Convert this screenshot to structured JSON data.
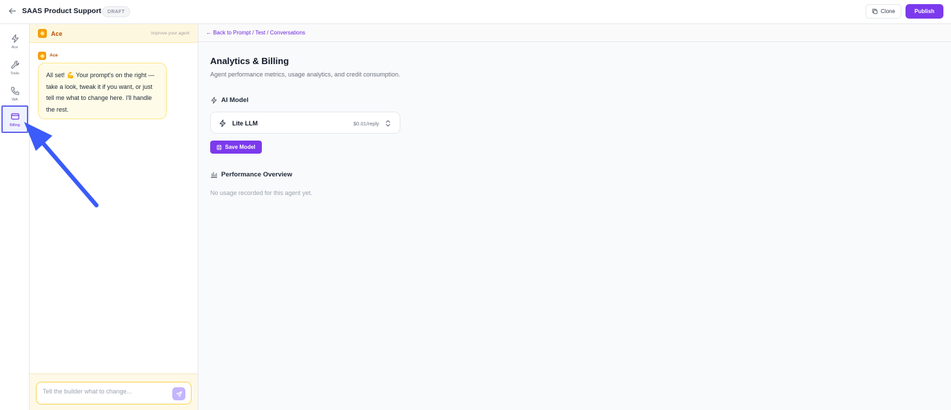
{
  "header": {
    "title": "SAAS Product Support",
    "badge": "DRAFT",
    "clone_label": "Clone",
    "publish_label": "Publish"
  },
  "rail": {
    "items": [
      {
        "label": "Ace",
        "icon": "bolt-icon"
      },
      {
        "label": "Tools",
        "icon": "wrench-icon"
      },
      {
        "label": "WA",
        "icon": "phone-icon"
      },
      {
        "label": "Billing",
        "icon": "credit-card-icon",
        "active": true
      }
    ]
  },
  "chat": {
    "header_name": "Ace",
    "header_hint": "Improve your agent",
    "message_author": "Ace",
    "message_text": "All set! 💪 Your prompt's on the right — take a look, tweak it if you want, or just tell me what to change here. I'll handle the rest.",
    "composer_placeholder": "Tell the builder what to change..."
  },
  "main": {
    "breadcrumb": "← Back to Prompt / Test / Conversations",
    "title": "Analytics & Billing",
    "subtitle": "Agent performance metrics, usage analytics, and credit consumption.",
    "ai_model_heading": "AI Model",
    "model_name": "Lite LLM",
    "model_price": "$0.01/reply",
    "save_label": "Save Model",
    "performance_heading": "Performance Overview",
    "empty_message": "No usage recorded for this agent yet."
  },
  "colors": {
    "accent": "#7c3aed",
    "highlight": "#6366f1",
    "ace_orange": "#f59e0b",
    "annotation_arrow": "#3b5bfa"
  }
}
